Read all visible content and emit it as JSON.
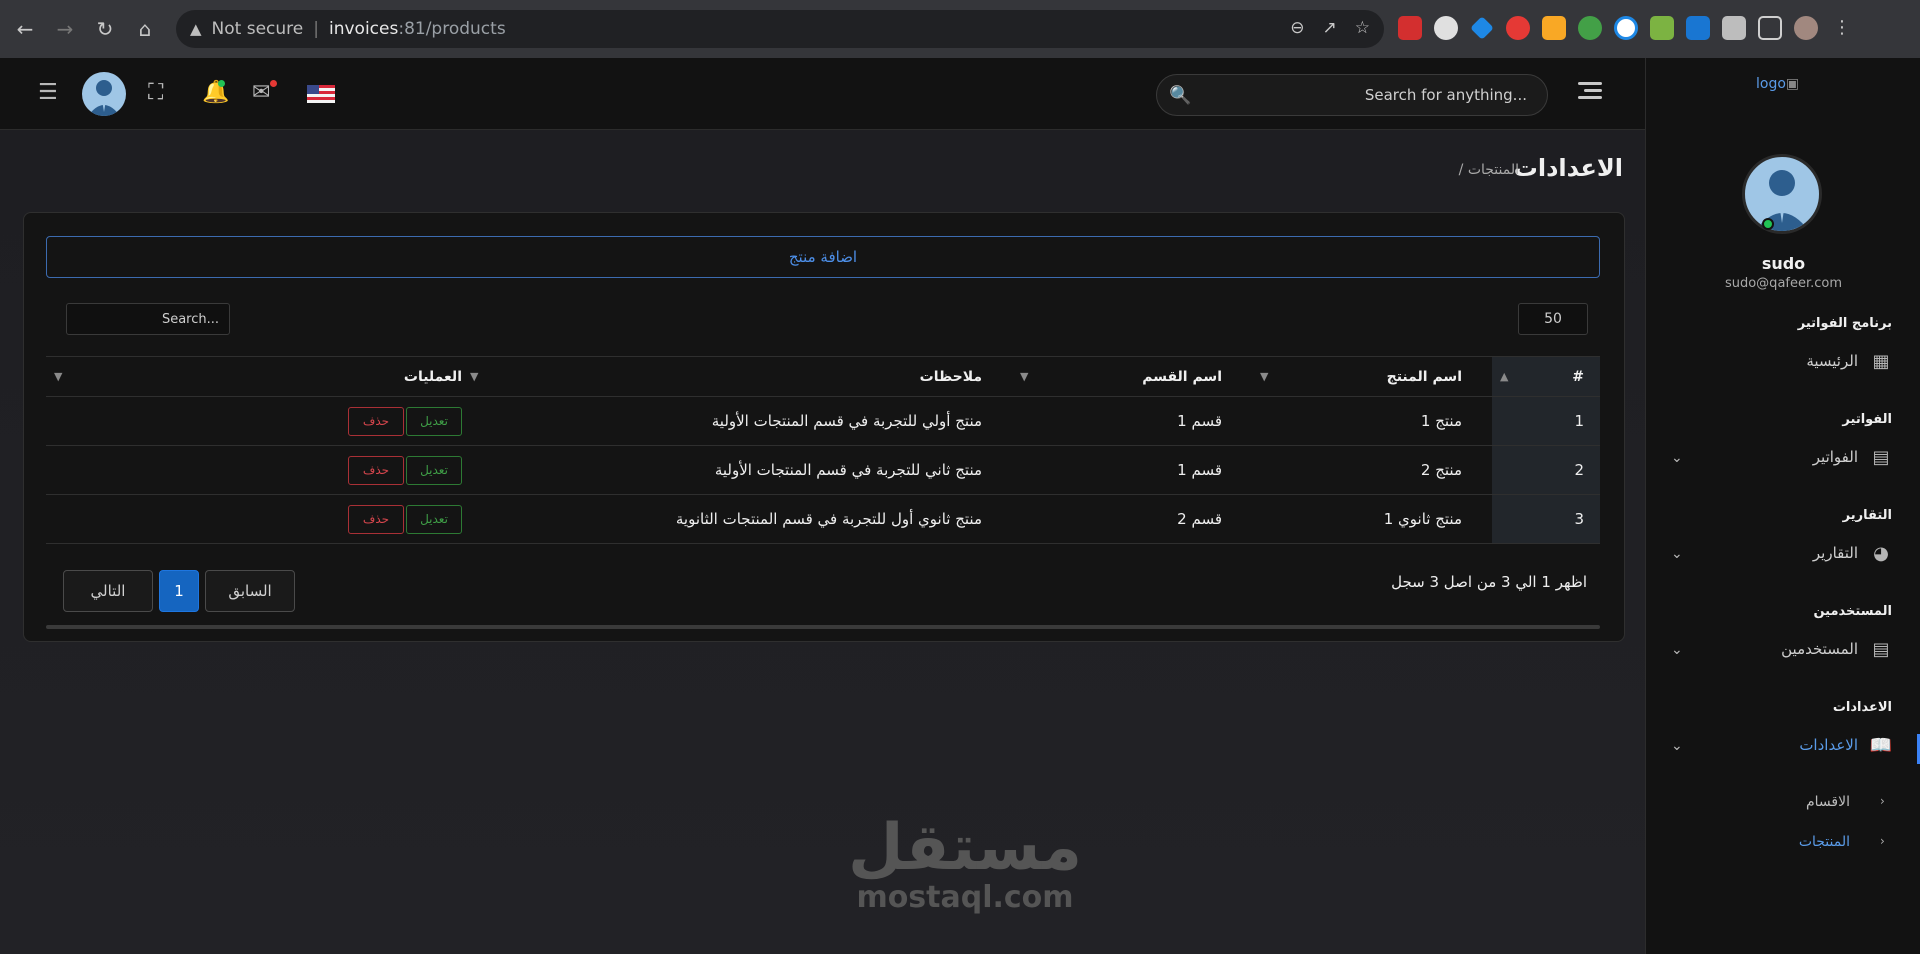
{
  "browser": {
    "warning_label": "Not secure",
    "url_host": "invoices",
    "url_port_path": ":81/products"
  },
  "header": {
    "search_placeholder": "Search for anything..."
  },
  "page": {
    "title": "الاعدادات",
    "breadcrumb": "/ المنتجات"
  },
  "card": {
    "add_button": "اضافة منتج",
    "page_length": "50",
    "search_placeholder": "Search..."
  },
  "table": {
    "headers": [
      "#",
      "اسم المنتج",
      "اسم القسم",
      "ملاحظات",
      "العمليات"
    ],
    "rows": [
      {
        "num": "1",
        "name": "منتج 1",
        "category": "قسم 1",
        "notes": "منتج أولي للتجربة في قسم المنتجات الأولية"
      },
      {
        "num": "2",
        "name": "منتج 2",
        "category": "قسم 1",
        "notes": "منتج ثاني للتجربة في قسم المنتجات الأولية"
      },
      {
        "num": "3",
        "name": "منتج ثانوي 1",
        "category": "قسم 2",
        "notes": "منتج ثانوي أول للتجربة في قسم المنتجات الثانوية"
      }
    ],
    "edit_label": "تعديل",
    "delete_label": "حذف"
  },
  "footer": {
    "info": "اظهر 1 الي 3 من اصل 3 سجل",
    "prev": "السابق",
    "page": "1",
    "next": "التالي"
  },
  "sidebar": {
    "logo_alt": "logo",
    "user_name": "sudo",
    "user_email": "sudo@qafeer.com",
    "sections": [
      {
        "title": "برنامج الفواتير",
        "item": "الرئيسية"
      },
      {
        "title": "الفواتير",
        "item": "الفواتير"
      },
      {
        "title": "التقارير",
        "item": "التقارير"
      },
      {
        "title": "المستخدمين",
        "item": "المستخدمين"
      },
      {
        "title": "الاعدادات",
        "item": "الاعدادات"
      }
    ],
    "sub_items": [
      "الاقسام",
      "المنتجات"
    ]
  },
  "watermark": {
    "arabic": "مستقل",
    "latin": "mostaql.com"
  },
  "colors": {
    "accent": "#3b82f6",
    "edit": "#3f9e47",
    "delete": "#d8464d",
    "online": "#21c255"
  }
}
